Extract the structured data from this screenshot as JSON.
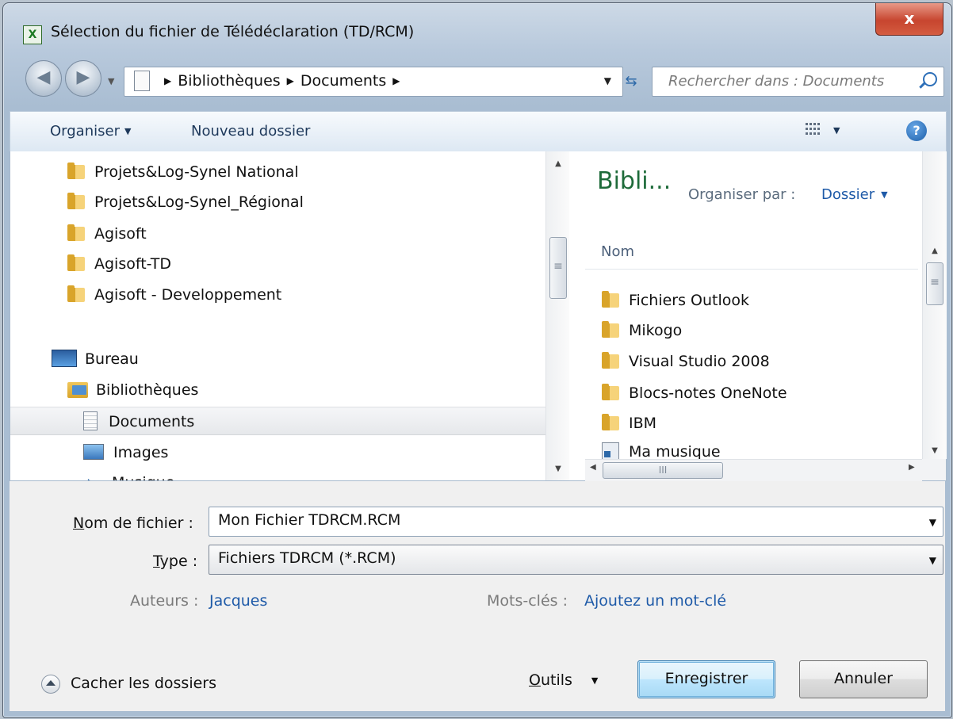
{
  "window": {
    "title": "Sélection du fichier de Télédéclaration (TD/RCM)",
    "close_glyph": "x",
    "icon": "excel-app-icon"
  },
  "navigation": {
    "breadcrumbs": [
      "Bibliothèques",
      "Documents"
    ],
    "search_placeholder": "Rechercher dans : Documents"
  },
  "toolbar": {
    "organize_label": "Organiser",
    "new_folder_label": "Nouveau dossier"
  },
  "nav_tree": {
    "favorite_folders": [
      {
        "label": "Projets&Log-Synel National"
      },
      {
        "label": "Projets&Log-Synel_Régional"
      },
      {
        "label": "Agisoft"
      },
      {
        "label": "Agisoft-TD"
      },
      {
        "label": "Agisoft - Developpement"
      }
    ],
    "desktop": "Bureau",
    "libraries": "Bibliothèques",
    "documents": "Documents",
    "images": "Images",
    "music": "Musique",
    "selected": "Documents"
  },
  "content": {
    "library_title": "Bibli...",
    "arrange_by_label": "Organiser par :",
    "arrange_by_value": "Dossier",
    "column_name": "Nom",
    "items": [
      {
        "label": "Fichiers Outlook",
        "icon": "folder-icon"
      },
      {
        "label": "Mikogo",
        "icon": "folder-icon"
      },
      {
        "label": "Visual Studio 2008",
        "icon": "folder-icon"
      },
      {
        "label": "Blocs-notes OneNote",
        "icon": "folder-icon"
      },
      {
        "label": "IBM",
        "icon": "folder-icon"
      },
      {
        "label": "Ma musique",
        "icon": "shortcut-icon"
      }
    ]
  },
  "form": {
    "filename_label_u": "N",
    "filename_label_rest": "om de fichier :",
    "filename_value": "Mon Fichier TDRCM.RCM",
    "type_label_u": "T",
    "type_label_rest": "ype :",
    "type_value": "Fichiers TDRCM (*.RCM)",
    "authors_label": "Auteurs :",
    "authors_value": "Jacques",
    "tags_label": "Mots-clés :",
    "tags_value": "Ajoutez un mot-clé"
  },
  "footer": {
    "hide_folders_label": "Cacher les dossiers",
    "tools_label_u": "O",
    "tools_label_rest": "utils",
    "save_label": "Enregistrer",
    "cancel_label": "Annuler"
  }
}
